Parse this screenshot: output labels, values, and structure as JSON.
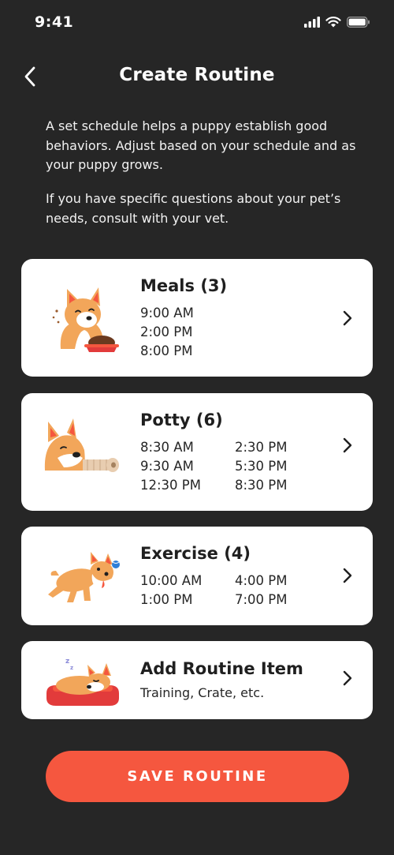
{
  "status_bar": {
    "time": "9:41"
  },
  "header": {
    "title": "Create Routine"
  },
  "intro": {
    "paragraph_1": "A set schedule helps a puppy establish good behaviors. Adjust based on your schedule and as your puppy grows.",
    "paragraph_2": "If you have specific questions about your pet’s needs, consult with your vet."
  },
  "routines": {
    "meals": {
      "title": "Meals (3)",
      "times": [
        "9:00 AM",
        "2:00 PM",
        "8:00 PM"
      ]
    },
    "potty": {
      "title": "Potty (6)",
      "times_col1": [
        "8:30 AM",
        "9:30 AM",
        "12:30 PM"
      ],
      "times_col2": [
        "2:30 PM",
        "5:30 PM",
        "8:30 PM"
      ]
    },
    "exercise": {
      "title": "Exercise (4)",
      "times_col1": [
        "10:00 AM",
        "1:00 PM"
      ],
      "times_col2": [
        "4:00 PM",
        "7:00 PM"
      ]
    },
    "add_item": {
      "title": "Add Routine Item",
      "subtitle": "Training, Crate, etc."
    }
  },
  "save_button": {
    "label": "SAVE ROUTINE"
  },
  "colors": {
    "background": "#262626",
    "card": "#ffffff",
    "accent": "#f5573f",
    "dog_orange": "#f2a65a"
  },
  "icons": {
    "back": "chevron-left-icon",
    "chevron": "chevron-right-icon",
    "signal": "signal-icon",
    "wifi": "wifi-icon",
    "battery": "battery-icon"
  }
}
